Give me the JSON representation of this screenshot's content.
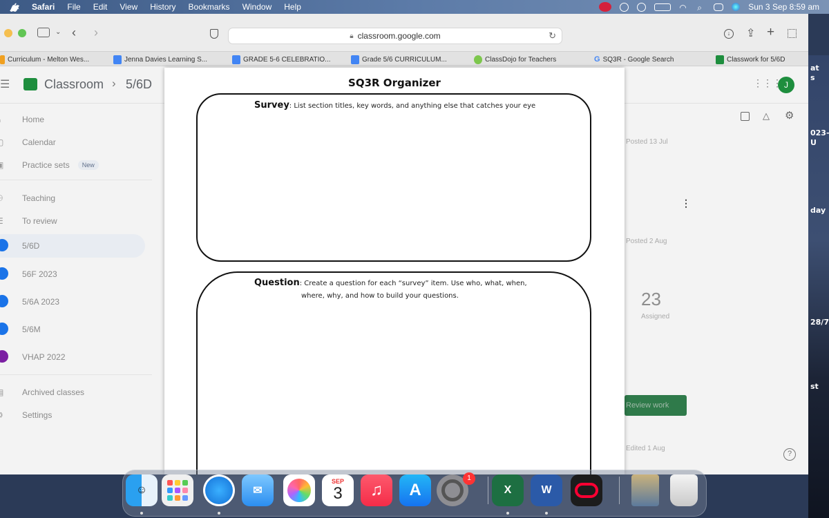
{
  "menubar": {
    "items": [
      "Safari",
      "File",
      "Edit",
      "View",
      "History",
      "Bookmarks",
      "Window",
      "Help"
    ],
    "datetime": "Sun 3 Sep  8:59 am"
  },
  "browser": {
    "url": "classroom.google.com",
    "tabs": [
      {
        "label": "Curriculum - Melton Wes..."
      },
      {
        "label": "Jenna Davies Learning S..."
      },
      {
        "label": "GRADE 5-6 CELEBRATIO..."
      },
      {
        "label": "Grade 5/6 CURRICULUM..."
      },
      {
        "label": "ClassDojo for Teachers"
      },
      {
        "label": "SQ3R - Google Search"
      },
      {
        "label": "Classwork for 5/6D"
      }
    ]
  },
  "classroom": {
    "app_name": "Classroom",
    "breadcrumb": "5/6D",
    "avatar_letter": "J",
    "nav": [
      {
        "label": "Home"
      },
      {
        "label": "Calendar"
      },
      {
        "label": "Practice sets",
        "badge": "New"
      },
      {
        "label": "Teaching"
      },
      {
        "label": "To review"
      },
      {
        "label": "5/6D"
      },
      {
        "label": "56F 2023"
      },
      {
        "label": "5/6A 2023"
      },
      {
        "label": "5/6M"
      },
      {
        "label": "VHAP 2022"
      },
      {
        "label": "Archived classes"
      },
      {
        "label": "Settings"
      }
    ],
    "panel": {
      "posted_1": "Posted 13 Jul",
      "posted_2": "Posted 2 Aug",
      "count": "23",
      "count_label": "Assigned",
      "review_button": "Review work",
      "edited": "Edited 1 Aug"
    }
  },
  "document": {
    "title": "SQ3R Organizer",
    "survey_heading": "Survey",
    "survey_text": ": List section titles, key words, and anything else that catches your eye",
    "question_heading": "Question",
    "question_text_1": ":  Create a question for each “survey” item.  Use who, what, when,",
    "question_text_2": "where, why, and how to build your questions."
  },
  "dock": {
    "calendar_month": "SEP",
    "calendar_day": "3",
    "settings_badge": "1"
  },
  "wallpaper_fragments": [
    "at",
    "s",
    "023-",
    "U",
    "day",
    "28/7",
    "st"
  ],
  "colors": {
    "classroom_green": "#1e8e3e",
    "accent_blue": "#1a73e8"
  }
}
